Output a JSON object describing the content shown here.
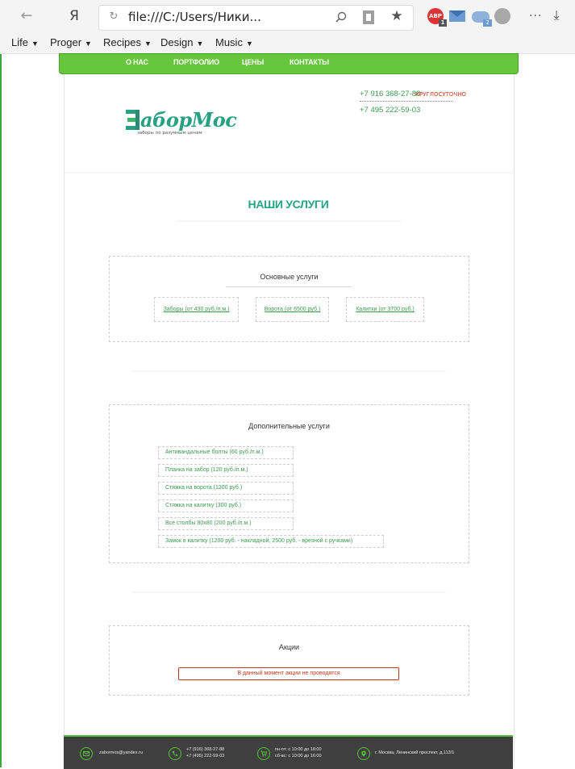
{
  "browser": {
    "address_bar_text": "file:///C:/Users/Ники...",
    "bookmarks": [
      {
        "label": "Life"
      },
      {
        "label": "Proger"
      },
      {
        "label": "Recipes"
      },
      {
        "label": "Design"
      },
      {
        "label": "Music"
      }
    ],
    "extensions": {
      "adblock_label": "ABP",
      "adblock_count": "1",
      "cloud_count": "2"
    }
  },
  "site": {
    "nav": [
      "О НАС",
      "ПОРТФОЛИО",
      "ЦЕНЫ",
      "КОНТАКТЫ"
    ],
    "logo": {
      "name": "ЗаборМос",
      "name_tail": "аборМос",
      "tagline": "заборы по разумным ценам"
    },
    "contacts": {
      "phone1": "+7 916 368-27-88",
      "phone1_note": "КРУГЛОСУТОЧНО",
      "phone2": "+7 495 222-59-03"
    },
    "section_title": "НАШИ УСЛУГИ",
    "main_services": {
      "title": "Основные услуги",
      "items": [
        "Заборы (от 430 руб./п.м.)",
        "Ворота (от 6500 руб.)",
        "Калитки (от 3700 руб.)"
      ]
    },
    "extra_services": {
      "title": "Дополнительные услуги",
      "items": [
        "Антивандальные болты (60 руб./п.м.)",
        "Планка на забор (120 руб./п.м.)",
        "Стяжка на ворота (1200 руб.)",
        "Стяжка на калитку (300 руб.)",
        "Все столбы 80х80 (200 руб./п.м.)",
        "Замок в калитку (1200 руб. - накладной, 2500 руб. - врезной с ручками)"
      ]
    },
    "promos": {
      "title": "Акции",
      "message": "В данный момент акции не проводятся"
    },
    "footer": {
      "email": "zabormos@yandex.ru",
      "phone_a": "+7 (916) 368-27-88",
      "phone_b": "+7 (495) 222-59-03",
      "hours_a": "пн-пт: с 10:00 до 18:00",
      "hours_b": "сб-вс: с 10:00 до 16:00",
      "address": "г. Москва, Ленинский проспект, д.113/1"
    }
  },
  "colors": {
    "nav_green": "#66c73c",
    "brand_teal": "#27a084",
    "link_green": "#3b9a4e",
    "alert_red": "#c0391b",
    "footer_dark": "#3f3f3f"
  }
}
